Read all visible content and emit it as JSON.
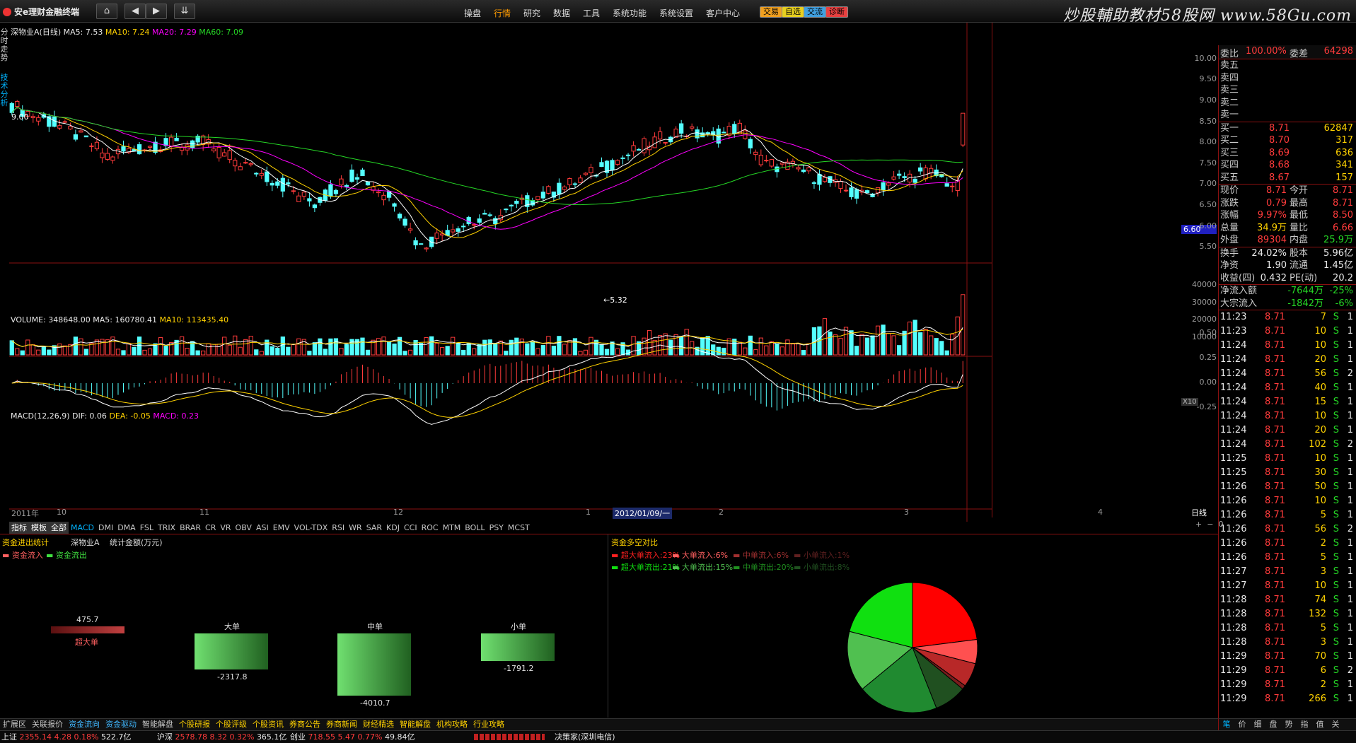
{
  "window": {
    "title": "安e理财金融终端"
  },
  "toolbar": {
    "home": "⌂",
    "prev": "◀",
    "next": "▶",
    "menu_down": "⇊"
  },
  "menus": [
    "操盘",
    "行情",
    "研究",
    "数据",
    "工具",
    "系统功能",
    "系统设置",
    "客户中心"
  ],
  "active_menu": "行情",
  "quick_buttons": [
    {
      "label": "交易",
      "color": "#f0a020"
    },
    {
      "label": "自选",
      "color": "#e8d020"
    },
    {
      "label": "交流",
      "color": "#40a0e0"
    },
    {
      "label": "诊断",
      "color": "#e84040"
    }
  ],
  "watermark": "炒股輔助教材58股网 www.58Gu.com",
  "vtabs": {
    "time": "分时走势",
    "tech": "技术分析"
  },
  "price_chart": {
    "label": "深物业A(日线)",
    "ma5": "MA5: 7.53",
    "ma10": "MA10: 7.24",
    "ma20": "MA20: 7.29",
    "ma60": "MA60: 7.09",
    "high_mark": "9.00",
    "low_mark": "←5.32",
    "cur_price_tag": "6.60",
    "yaxis": [
      "10.00",
      "9.50",
      "9.00",
      "8.50",
      "8.00",
      "7.50",
      "7.00",
      "6.50",
      "6.00",
      "5.50"
    ],
    "colors": {
      "ma5": "#ffffff",
      "ma10": "#ffd200",
      "ma20": "#ff00ff",
      "ma60": "#25d625",
      "up": "#ff3b3b",
      "down": "#54ffff"
    }
  },
  "volume_chart": {
    "label": "VOLUME: 348648.00",
    "ma5": "MA5: 160780.41",
    "ma10": "MA10: 113435.40",
    "yaxis": [
      "40000",
      "30000",
      "20000",
      "10000"
    ],
    "unit": "X10"
  },
  "macd_chart": {
    "label": "MACD(12,26,9)",
    "dif": "DIF: 0.06",
    "dea": "DEA: -0.05",
    "macd": "MACD: 0.23",
    "yaxis": [
      "0.50",
      "0.25",
      "0.00",
      "-0.25"
    ]
  },
  "x_axis": {
    "labels": [
      "2011年",
      "10",
      "11",
      "12",
      "1",
      "2",
      "3",
      "4"
    ],
    "cursor_date": "2012/01/09/一",
    "period": "日线"
  },
  "indicator_tabs": [
    "指标",
    "模板",
    "全部",
    "MACD",
    "DMI",
    "DMA",
    "FSL",
    "TRIX",
    "BRAR",
    "CR",
    "VR",
    "OBV",
    "ASI",
    "EMV",
    "VOL-TDX",
    "RSI",
    "WR",
    "SAR",
    "KDJ",
    "CCI",
    "ROC",
    "MTM",
    "BOLL",
    "PSY",
    "MCST"
  ],
  "flow_panel": {
    "title": "资金进出统计",
    "stock": "深物业A",
    "unit": "统计金额(万元)",
    "legend_in": "资金流入",
    "legend_out": "资金流出",
    "groups": [
      {
        "name": "超大单",
        "value": 475.7
      },
      {
        "name": "大单",
        "value": -2317.8
      },
      {
        "name": "中单",
        "value": -4010.7
      },
      {
        "name": "小单",
        "value": -1791.2
      }
    ]
  },
  "pie_panel": {
    "title": "资金多空对比",
    "legend": [
      {
        "label": "超大单流入:",
        "pct": "23%",
        "color": "#ff2020"
      },
      {
        "label": "大单流入:",
        "pct": "6%",
        "color": "#ff6060"
      },
      {
        "label": "中单流入:",
        "pct": "6%",
        "color": "#a03030"
      },
      {
        "label": "小单流入:",
        "pct": "1%",
        "color": "#602020"
      },
      {
        "label": "超大单流出:",
        "pct": "21%",
        "color": "#10e010"
      },
      {
        "label": "大单流出:",
        "pct": "15%",
        "color": "#50c050"
      },
      {
        "label": "中单流出:",
        "pct": "20%",
        "color": "#209020"
      },
      {
        "label": "小单流出:",
        "pct": "8%",
        "color": "#205020"
      }
    ],
    "slices": [
      23,
      6,
      6,
      1,
      8,
      20,
      15,
      21
    ],
    "slice_colors": [
      "#ff0000",
      "#ff5050",
      "#b82828",
      "#7a1c1c",
      "#205020",
      "#208a30",
      "#50c050",
      "#10e010"
    ]
  },
  "quote": {
    "ratio": {
      "k1": "委比",
      "v1": "100.00%",
      "k2": "委差",
      "v2": "64298"
    },
    "asks": [
      "卖五",
      "卖四",
      "卖三",
      "卖二",
      "卖一"
    ],
    "bids": [
      {
        "k": "买一",
        "p": "8.71",
        "v": "62847"
      },
      {
        "k": "买二",
        "p": "8.70",
        "v": "317"
      },
      {
        "k": "买三",
        "p": "8.69",
        "v": "636"
      },
      {
        "k": "买四",
        "p": "8.68",
        "v": "341"
      },
      {
        "k": "买五",
        "p": "8.67",
        "v": "157"
      }
    ],
    "stats": [
      [
        {
          "k": "现价",
          "v": "8.71",
          "c": "red"
        },
        {
          "k": "今开",
          "v": "8.71",
          "c": "red"
        }
      ],
      [
        {
          "k": "涨跌",
          "v": "0.79",
          "c": "red"
        },
        {
          "k": "最高",
          "v": "8.71",
          "c": "red"
        }
      ],
      [
        {
          "k": "涨幅",
          "v": "9.97%",
          "c": "red"
        },
        {
          "k": "最低",
          "v": "8.50",
          "c": "red"
        }
      ],
      [
        {
          "k": "总量",
          "v": "34.9万",
          "c": "yellow"
        },
        {
          "k": "量比",
          "v": "6.66",
          "c": "red"
        }
      ],
      [
        {
          "k": "外盘",
          "v": "89304",
          "c": "red"
        },
        {
          "k": "内盘",
          "v": "25.9万",
          "c": "green"
        }
      ],
      [
        {
          "k": "换手",
          "v": "24.02%",
          "c": "white"
        },
        {
          "k": "股本",
          "v": "5.96亿",
          "c": "white"
        }
      ],
      [
        {
          "k": "净资",
          "v": "1.90",
          "c": "white"
        },
        {
          "k": "流通",
          "v": "1.45亿",
          "c": "white"
        }
      ],
      [
        {
          "k": "收益(四)",
          "v": "0.432",
          "c": "white"
        },
        {
          "k": "PE(动)",
          "v": "20.2",
          "c": "white"
        }
      ]
    ],
    "net_flow": {
      "k": "净流入额",
      "v1": "-7644万",
      "v2": "-25%"
    },
    "block_flow": {
      "k": "大宗流入",
      "v1": "-1842万",
      "v2": "-6%"
    }
  },
  "ticks": [
    {
      "t": "11:23",
      "p": "8.71",
      "v": "7",
      "d": "S",
      "n": "1"
    },
    {
      "t": "11:23",
      "p": "8.71",
      "v": "10",
      "d": "S",
      "n": "1"
    },
    {
      "t": "11:24",
      "p": "8.71",
      "v": "10",
      "d": "S",
      "n": "1"
    },
    {
      "t": "11:24",
      "p": "8.71",
      "v": "20",
      "d": "S",
      "n": "1"
    },
    {
      "t": "11:24",
      "p": "8.71",
      "v": "56",
      "d": "S",
      "n": "2"
    },
    {
      "t": "11:24",
      "p": "8.71",
      "v": "40",
      "d": "S",
      "n": "1"
    },
    {
      "t": "11:24",
      "p": "8.71",
      "v": "15",
      "d": "S",
      "n": "1"
    },
    {
      "t": "11:24",
      "p": "8.71",
      "v": "10",
      "d": "S",
      "n": "1"
    },
    {
      "t": "11:24",
      "p": "8.71",
      "v": "20",
      "d": "S",
      "n": "1"
    },
    {
      "t": "11:24",
      "p": "8.71",
      "v": "102",
      "d": "S",
      "n": "2"
    },
    {
      "t": "11:25",
      "p": "8.71",
      "v": "10",
      "d": "S",
      "n": "1"
    },
    {
      "t": "11:25",
      "p": "8.71",
      "v": "30",
      "d": "S",
      "n": "1"
    },
    {
      "t": "11:26",
      "p": "8.71",
      "v": "50",
      "d": "S",
      "n": "1"
    },
    {
      "t": "11:26",
      "p": "8.71",
      "v": "10",
      "d": "S",
      "n": "1"
    },
    {
      "t": "11:26",
      "p": "8.71",
      "v": "5",
      "d": "S",
      "n": "1"
    },
    {
      "t": "11:26",
      "p": "8.71",
      "v": "56",
      "d": "S",
      "n": "2"
    },
    {
      "t": "11:26",
      "p": "8.71",
      "v": "2",
      "d": "S",
      "n": "1"
    },
    {
      "t": "11:26",
      "p": "8.71",
      "v": "5",
      "d": "S",
      "n": "1"
    },
    {
      "t": "11:27",
      "p": "8.71",
      "v": "3",
      "d": "S",
      "n": "1"
    },
    {
      "t": "11:27",
      "p": "8.71",
      "v": "10",
      "d": "S",
      "n": "1"
    },
    {
      "t": "11:28",
      "p": "8.71",
      "v": "74",
      "d": "S",
      "n": "1"
    },
    {
      "t": "11:28",
      "p": "8.71",
      "v": "132",
      "d": "S",
      "n": "1"
    },
    {
      "t": "11:28",
      "p": "8.71",
      "v": "5",
      "d": "S",
      "n": "1"
    },
    {
      "t": "11:28",
      "p": "8.71",
      "v": "3",
      "d": "S",
      "n": "1"
    },
    {
      "t": "11:29",
      "p": "8.71",
      "v": "70",
      "d": "S",
      "n": "1"
    },
    {
      "t": "11:29",
      "p": "8.71",
      "v": "6",
      "d": "S",
      "n": "2"
    },
    {
      "t": "11:29",
      "p": "8.71",
      "v": "2",
      "d": "S",
      "n": "1"
    },
    {
      "t": "11:29",
      "p": "8.71",
      "v": "266",
      "d": "S",
      "n": "1"
    }
  ],
  "right_tabs": [
    "笔",
    "价",
    "细",
    "盘",
    "势",
    "指",
    "值",
    "关"
  ],
  "footer_nav": [
    "扩展区",
    "关联报价",
    "资金流向",
    "资金驱动",
    "智能解盘",
    "个股研报",
    "个股评级",
    "个股资讯",
    "券商公告",
    "券商新闻",
    "财经精选",
    "智能解盘",
    "机构攻略",
    "行业攻略"
  ],
  "footer_nav_active": [
    "资金流向",
    "资金驱动"
  ],
  "status": [
    {
      "name": "上证",
      "val": "2355.14",
      "chg": "4.28",
      "pct": "0.18%",
      "amt": "522.7亿"
    },
    {
      "name": "沪深",
      "val": "2578.78",
      "chg": "8.32",
      "pct": "0.32%",
      "amt": "365.1亿"
    },
    {
      "name": "创业",
      "val": "718.55",
      "chg": "5.47",
      "pct": "0.77%",
      "amt": "49.84亿"
    }
  ],
  "status_source": "决策家(深圳电信)"
}
